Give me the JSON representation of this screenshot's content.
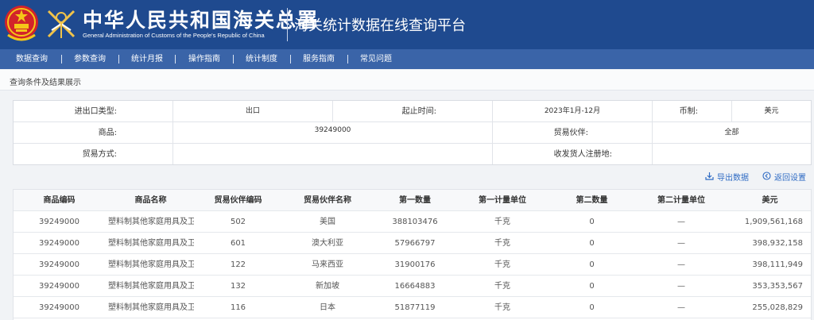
{
  "header": {
    "title_cn": "中华人民共和国海关总署",
    "title_en": "General Administration of Customs of the People's Republic of China",
    "platform": "海关统计数据在线查询平台",
    "emblem_icon": "national-emblem-icon",
    "logo_icon": "customs-emblem-icon",
    "brand_color": "#1f4a8f"
  },
  "nav": {
    "items": [
      "数据查询",
      "参数查询",
      "统计月报",
      "操作指南",
      "统计制度",
      "服务指南",
      "常见问题"
    ]
  },
  "breadcrumb": "查询条件及结果展示",
  "conditions": {
    "trade_type_label": "进出口类型:",
    "trade_type_value": "出口",
    "period_label": "起止时间:",
    "period_value": "2023年1月-12月",
    "currency_label": "币制:",
    "currency_value": "美元",
    "commodity_label": "商品:",
    "commodity_value": "39249000",
    "partner_label": "贸易伙伴:",
    "partner_value": "全部",
    "trade_mode_label": "贸易方式:",
    "trade_mode_value": "",
    "region_label": "收发货人注册地:",
    "region_value": ""
  },
  "actions": {
    "export_label": "导出数据",
    "export_icon": "download-icon",
    "reset_label": "返回设置",
    "reset_icon": "back-circle-icon",
    "link_color": "#2f6bc4"
  },
  "table": {
    "columns": [
      "商品编码",
      "商品名称",
      "贸易伙伴编码",
      "贸易伙伴名称",
      "第一数量",
      "第一计量单位",
      "第二数量",
      "第二计量单位",
      "美元"
    ],
    "rows": [
      [
        "39249000",
        "塑料制其他家庭用具及卫生或盥洗用具",
        "502",
        "美国",
        "388103476",
        "千克",
        "0",
        "—",
        "1,909,561,168"
      ],
      [
        "39249000",
        "塑料制其他家庭用具及卫生或盥洗用具",
        "601",
        "澳大利亚",
        "57966797",
        "千克",
        "0",
        "—",
        "398,932,158"
      ],
      [
        "39249000",
        "塑料制其他家庭用具及卫生或盥洗用具",
        "122",
        "马来西亚",
        "31900176",
        "千克",
        "0",
        "—",
        "398,111,949"
      ],
      [
        "39249000",
        "塑料制其他家庭用具及卫生或盥洗用具",
        "132",
        "新加坡",
        "16664883",
        "千克",
        "0",
        "—",
        "353,353,567"
      ],
      [
        "39249000",
        "塑料制其他家庭用具及卫生或盥洗用具",
        "116",
        "日本",
        "51877119",
        "千克",
        "0",
        "—",
        "255,028,829"
      ]
    ]
  }
}
